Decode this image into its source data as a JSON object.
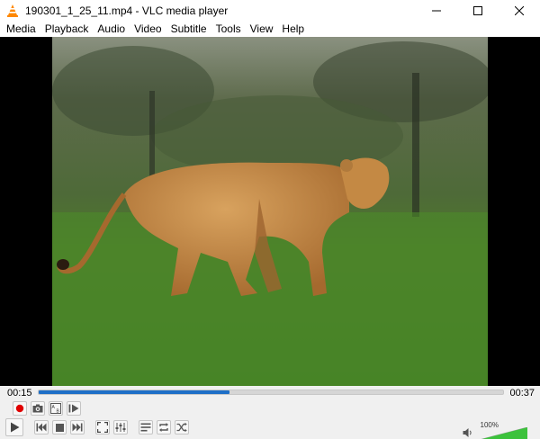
{
  "window": {
    "title": "190301_1_25_11.mp4 - VLC media player"
  },
  "menu": {
    "items": [
      "Media",
      "Playback",
      "Audio",
      "Video",
      "Subtitle",
      "Tools",
      "View",
      "Help"
    ]
  },
  "playback": {
    "elapsed": "00:15",
    "total": "00:37",
    "progress_fraction": 0.41
  },
  "volume": {
    "label": "100%",
    "level_fraction": 1.0
  },
  "colors": {
    "seek_fill": "#1e6fc7",
    "record_button": "#e00000",
    "volume_fill": "#3cc23c",
    "vlc_cone": "#ff8800"
  },
  "icons": {
    "app": "vlc-cone-icon",
    "record": "record-icon",
    "snapshot": "camera-icon",
    "loop_ab": "loop-ab-icon",
    "frame_step": "frame-step-icon",
    "play": "play-icon",
    "previous": "previous-icon",
    "stop": "stop-icon",
    "next": "next-icon",
    "fullscreen": "fullscreen-icon",
    "extended_settings": "equalizer-icon",
    "playlist": "playlist-icon",
    "loop": "loop-icon",
    "shuffle": "shuffle-icon",
    "volume": "speaker-icon"
  }
}
